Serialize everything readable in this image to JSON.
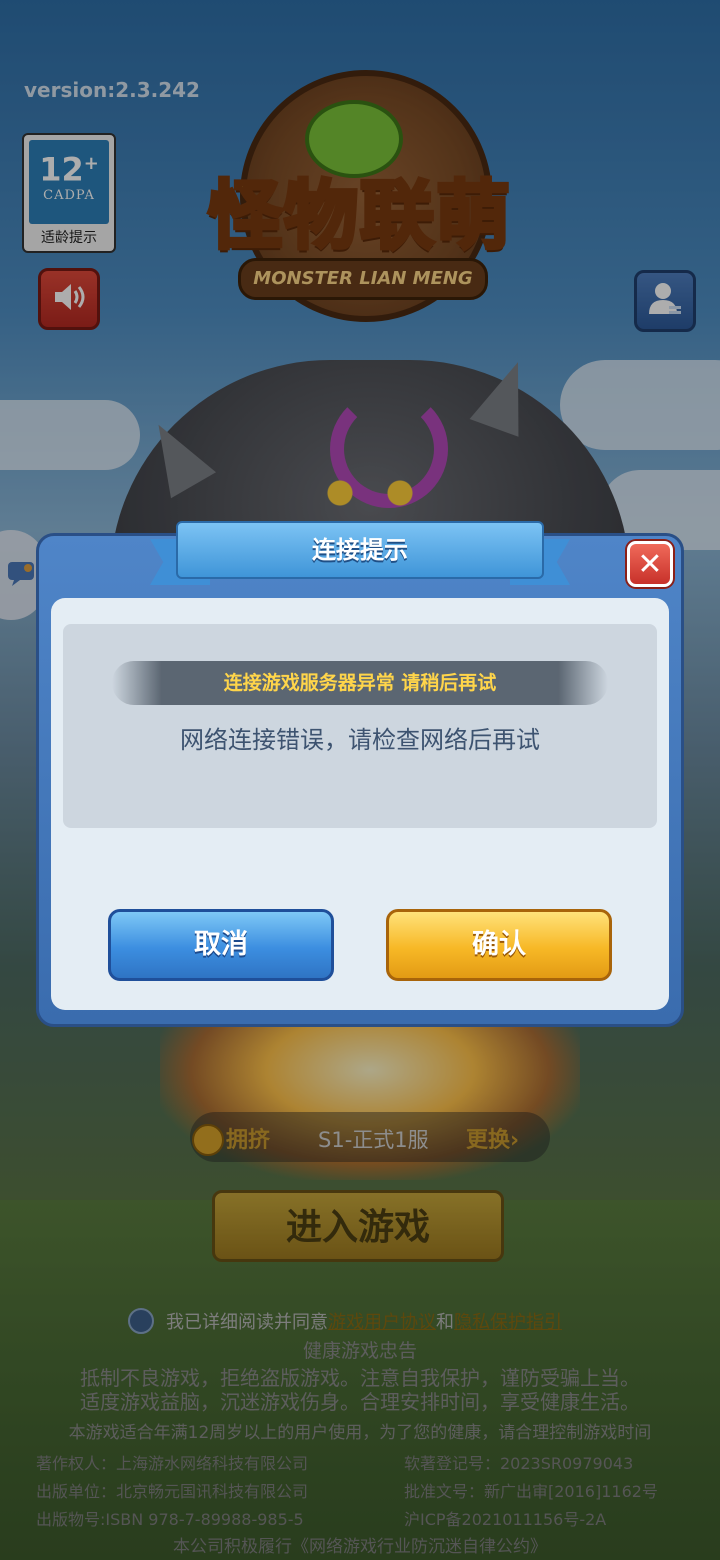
{
  "version": "version:2.3.242",
  "age_badge": {
    "rating": "12",
    "plus": "+",
    "org": "CADPA",
    "caption": "适龄提示"
  },
  "logo": {
    "title": "怪物联萌",
    "subtitle": "MONSTER LIAN MENG"
  },
  "icons": {
    "sound": "speaker-icon",
    "account": "account-icon",
    "close": "close-icon",
    "chat": "chat-icon",
    "check": "check-icon",
    "coin": "coin-icon"
  },
  "dialog": {
    "title": "连接提示",
    "error_strip": "连接游戏服务器异常 请稍后再试",
    "message": "网络连接错误，请检查网络后再试",
    "cancel_label": "取消",
    "confirm_label": "确认",
    "close_symbol": "✕"
  },
  "server": {
    "tag": "拥挤",
    "name": "S1-正式1服",
    "change": "更换›"
  },
  "enter_label": "进入游戏",
  "agreement": {
    "prefix": "我已详细阅读并同意",
    "link1": "游戏用户协议",
    "and": "和",
    "link2": "隐私保护指引"
  },
  "notice": {
    "title": "健康游戏忠告",
    "line1": "抵制不良游戏，拒绝盗版游戏。注意自我保护，谨防受骗上当。",
    "line2": "适度游戏益脑，沉迷游戏伤身。合理安排时间，享受健康生活。",
    "line3": "本游戏适合年满12周岁以上的用户使用，为了您的健康，请合理控制游戏时间"
  },
  "credits": [
    [
      "著作权人：上海游水网络科技有限公司",
      "软著登记号：2023SR0979043"
    ],
    [
      "出版单位：北京畅元国讯科技有限公司",
      "批准文号：新广出审[2016]1162号"
    ],
    [
      "出版物号:ISBN 978-7-89988-985-5",
      "沪ICP备2021011156号-2A"
    ]
  ],
  "pledge": "本公司积极履行《网络游戏行业防沉迷自律公约》",
  "colors": {
    "dialog_frame": "#3a6cae",
    "cancel": "#3c8ee0",
    "confirm": "#f7b826",
    "error_text": "#ffd54a",
    "message_text": "#3d5370"
  }
}
